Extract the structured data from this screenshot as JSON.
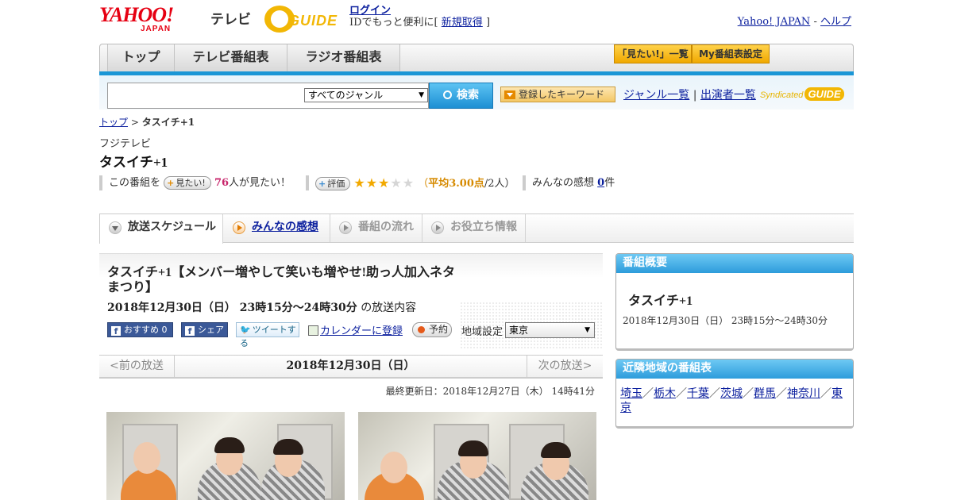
{
  "header": {
    "logo_text": "YAHOO!",
    "logo_sub": "JAPAN",
    "tv_label": "テレビ",
    "gguide_text": "GUIDE",
    "login_label": "ログイン",
    "login_note_pre": "IDでもっと便利に[",
    "register_label": "新規取得",
    "login_note_post": "]",
    "yahoo_japan_link": "Yahoo! JAPAN",
    "separator": "-",
    "help_link": "ヘルプ"
  },
  "global_nav": {
    "tabs": [
      {
        "label": "トップ"
      },
      {
        "label": "テレビ番組表"
      },
      {
        "label": "ラジオ番組表"
      }
    ],
    "mitai_list_label": "「見たい!」一覧",
    "my_program_label": "My番組表設定"
  },
  "search": {
    "input_value": "",
    "genre_selected": "すべてのジャンル",
    "search_button": "検索",
    "keyword_button": "登録したキーワード",
    "genre_list_link": "ジャンル一覧",
    "link_separator": "|",
    "performers_link": "出演者一覧",
    "syndicated_label": "Syndicated",
    "syndicated_g": "GUIDE"
  },
  "breadcrumb": {
    "top": "トップ",
    "sep": ">",
    "current": "タスイチ+1"
  },
  "program": {
    "station": "フジテレビ",
    "title": "タスイチ+1"
  },
  "stats": {
    "want_prefix": "この番組を",
    "want_button": "見たい!",
    "want_count": "76",
    "want_suffix": "人が見たい！",
    "eval_button": "評価",
    "rating_stars": 3,
    "rating_open": "（",
    "rating_avg": "平均3.00点",
    "rating_people": "/2人）",
    "impressions_label": "みんなの感想",
    "impressions_count": "0",
    "impressions_unit": "件"
  },
  "content_tabs": [
    {
      "label": "放送スケジュール",
      "state": "active"
    },
    {
      "label": "みんなの感想",
      "state": "link"
    },
    {
      "label": "番組の流れ",
      "state": "disabled"
    },
    {
      "label": "お役立ち情報",
      "state": "disabled"
    }
  ],
  "episode": {
    "title": "タスイチ+1【メンバー増やして笑いも増やせ!助っ人加入ネタまつり】",
    "datetime": "2018年12月30日（日） 23時15分～24時30分",
    "datetime_suffix": "の放送内容",
    "fb_recommend": "おすすめ 0",
    "fb_share": "シェア",
    "tweet": "ツイートする",
    "calendar": "カレンダーに登録",
    "reserve": "予約",
    "region_label": "地域設定",
    "region_selected": "東京"
  },
  "pager": {
    "prev": "<前の放送",
    "current_date": "2018年12月30日（日）",
    "next": "次の放送>"
  },
  "last_updated": "最終更新日：2018年12月27日（木） 14時41分",
  "sidebar": {
    "summary_head": "番組概要",
    "summary_title": "タスイチ+1",
    "summary_time": "2018年12月30日（日） 23時15分～24時30分",
    "nearby_head": "近隣地域の番組表",
    "nearby_regions": [
      "埼玉",
      "栃木",
      "千葉",
      "茨城",
      "群馬",
      "神奈川",
      "東京"
    ],
    "nearby_separator": "／"
  },
  "colors": {
    "accent_blue": "#1a96d6",
    "link": "#0b1f9e",
    "want_pink": "#c8276c",
    "star": "#f2a900"
  }
}
